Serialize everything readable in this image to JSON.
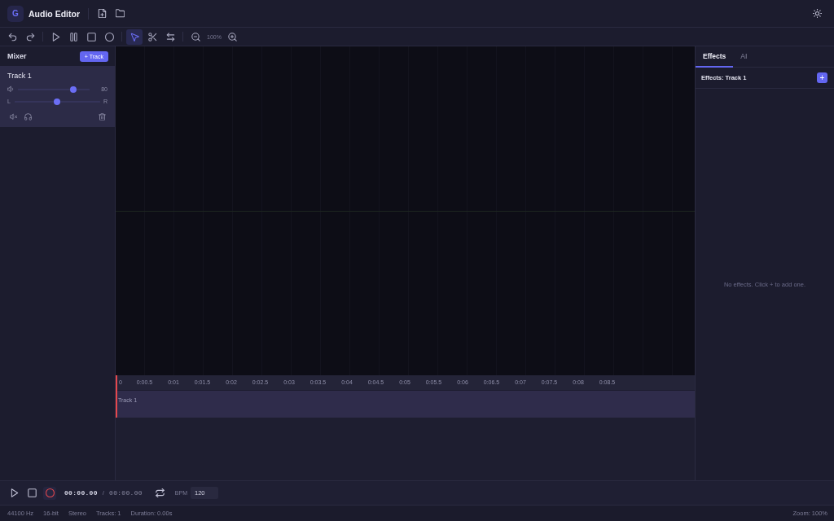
{
  "header": {
    "logo": "G",
    "title": "Audio Editor"
  },
  "toolbar": {
    "tools": [
      {
        "kind": "pointer",
        "selected": true
      },
      {
        "kind": "scissors",
        "selected": false
      },
      {
        "kind": "swap",
        "selected": false
      }
    ],
    "zoom": "100%"
  },
  "mixer": {
    "title": "Mixer",
    "add_button": "+ Track",
    "tracks": [
      {
        "name": "Track 1",
        "selected": true,
        "volume": {
          "level": 0.8,
          "reading": "80"
        },
        "pan": {
          "level": 0.5,
          "left": "L",
          "right": "R"
        }
      }
    ]
  },
  "timeline": {
    "ruler": [
      "0",
      "0:00.5",
      "0:01",
      "0:01.5",
      "0:02",
      "0:02.5",
      "0:03",
      "0:03.5",
      "0:04",
      "0:04.5",
      "0:05",
      "0:05.5",
      "0:06",
      "0:06.5",
      "0:07",
      "0:07.5",
      "0:08",
      "0:08.5"
    ],
    "lanes": [
      {
        "name": "Track 1"
      }
    ]
  },
  "effects_panel": {
    "tabs": [
      {
        "label": "Effects",
        "selected": true
      },
      {
        "label": "AI",
        "selected": false
      }
    ],
    "title": "Effects: Track 1",
    "add_button": "+",
    "empty_message": "No effects. Click + to add one."
  },
  "transport": {
    "time": "00:00.00",
    "separator": "/",
    "duration": "00:00.00",
    "bpm_label": "BPM",
    "bpm": "120"
  },
  "status_bar": {
    "items": [
      "44100 Hz",
      "16-bit",
      "Stereo",
      "Tracks: 1",
      "Duration: 0.00s"
    ],
    "zoom": "Zoom: 100%"
  }
}
